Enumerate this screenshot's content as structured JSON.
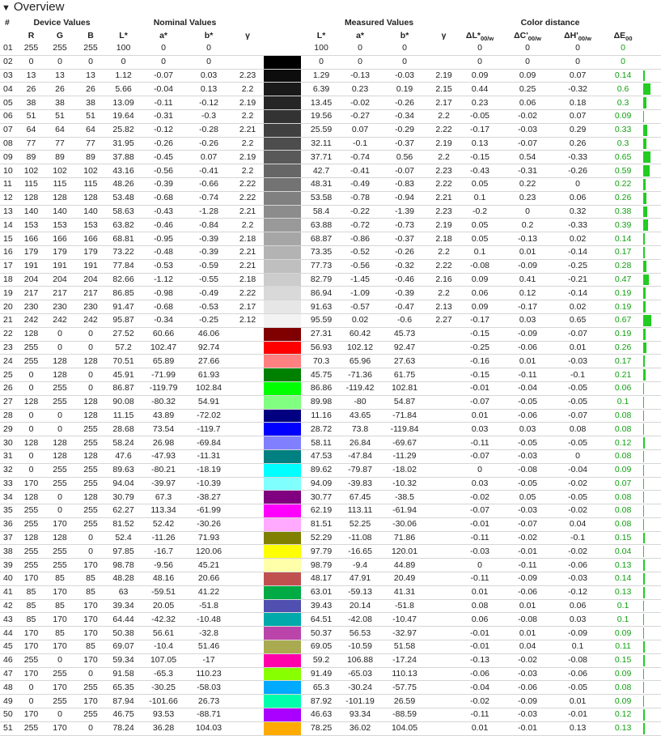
{
  "section": {
    "title": "Overview",
    "toggle_icon": "triangle-down-icon"
  },
  "groups": {
    "index": "#",
    "device": "Device Values",
    "nominal": "Nominal Values",
    "measured": "Measured Values",
    "distance": "Color distance"
  },
  "columns": {
    "r": "R",
    "g": "G",
    "b": "B",
    "nl": "L*",
    "na": "a*",
    "nb": "b*",
    "ng": "γ",
    "ml": "L*",
    "ma": "a*",
    "mb": "b*",
    "mg": "γ",
    "dl": "ΔL*",
    "dc": "ΔC'",
    "dh": "ΔH'",
    "de": "ΔE",
    "sub_dl": "00/w",
    "sub_dc": "00/w",
    "sub_dh": "00/w",
    "sub_de": "00"
  },
  "accent_color": "#22cc22",
  "rows": [
    {
      "id": "01",
      "r": "255",
      "g": "255",
      "b": "255",
      "nl": "100",
      "na": "0",
      "nb": "0",
      "ng": "",
      "swatch": "#ffffff",
      "ml": "100",
      "ma": "0",
      "mb": "0",
      "mg": "",
      "dl": "0",
      "dc": "0",
      "dh": "0",
      "de": "0",
      "bar": 0
    },
    {
      "id": "02",
      "r": "0",
      "g": "0",
      "b": "0",
      "nl": "0",
      "na": "0",
      "nb": "0",
      "ng": "",
      "swatch": "#000000",
      "ml": "0",
      "ma": "0",
      "mb": "0",
      "mg": "",
      "dl": "0",
      "dc": "0",
      "dh": "0",
      "de": "0",
      "bar": 0
    },
    {
      "id": "03",
      "r": "13",
      "g": "13",
      "b": "13",
      "nl": "1.12",
      "na": "-0.07",
      "nb": "0.03",
      "ng": "2.23",
      "swatch": "#0d0d0d",
      "ml": "1.29",
      "ma": "-0.13",
      "mb": "-0.03",
      "mg": "2.19",
      "dl": "0.09",
      "dc": "0.09",
      "dh": "0.07",
      "de": "0.14",
      "bar": 0.14
    },
    {
      "id": "04",
      "r": "26",
      "g": "26",
      "b": "26",
      "nl": "5.66",
      "na": "-0.04",
      "nb": "0.13",
      "ng": "2.2",
      "swatch": "#1a1a1a",
      "ml": "6.39",
      "ma": "0.23",
      "mb": "0.19",
      "mg": "2.15",
      "dl": "0.44",
      "dc": "0.25",
      "dh": "-0.32",
      "de": "0.6",
      "bar": 0.6
    },
    {
      "id": "05",
      "r": "38",
      "g": "38",
      "b": "38",
      "nl": "13.09",
      "na": "-0.11",
      "nb": "-0.12",
      "ng": "2.19",
      "swatch": "#262626",
      "ml": "13.45",
      "ma": "-0.02",
      "mb": "-0.26",
      "mg": "2.17",
      "dl": "0.23",
      "dc": "0.06",
      "dh": "0.18",
      "de": "0.3",
      "bar": 0.3
    },
    {
      "id": "06",
      "r": "51",
      "g": "51",
      "b": "51",
      "nl": "19.64",
      "na": "-0.31",
      "nb": "-0.3",
      "ng": "2.2",
      "swatch": "#333333",
      "ml": "19.56",
      "ma": "-0.27",
      "mb": "-0.34",
      "mg": "2.2",
      "dl": "-0.05",
      "dc": "-0.02",
      "dh": "0.07",
      "de": "0.09",
      "bar": 0.09
    },
    {
      "id": "07",
      "r": "64",
      "g": "64",
      "b": "64",
      "nl": "25.82",
      "na": "-0.12",
      "nb": "-0.28",
      "ng": "2.21",
      "swatch": "#404040",
      "ml": "25.59",
      "ma": "0.07",
      "mb": "-0.29",
      "mg": "2.22",
      "dl": "-0.17",
      "dc": "-0.03",
      "dh": "0.29",
      "de": "0.33",
      "bar": 0.33
    },
    {
      "id": "08",
      "r": "77",
      "g": "77",
      "b": "77",
      "nl": "31.95",
      "na": "-0.26",
      "nb": "-0.26",
      "ng": "2.2",
      "swatch": "#4d4d4d",
      "ml": "32.11",
      "ma": "-0.1",
      "mb": "-0.37",
      "mg": "2.19",
      "dl": "0.13",
      "dc": "-0.07",
      "dh": "0.26",
      "de": "0.3",
      "bar": 0.3
    },
    {
      "id": "09",
      "r": "89",
      "g": "89",
      "b": "89",
      "nl": "37.88",
      "na": "-0.45",
      "nb": "0.07",
      "ng": "2.19",
      "swatch": "#595959",
      "ml": "37.71",
      "ma": "-0.74",
      "mb": "0.56",
      "mg": "2.2",
      "dl": "-0.15",
      "dc": "0.54",
      "dh": "-0.33",
      "de": "0.65",
      "bar": 0.65
    },
    {
      "id": "10",
      "r": "102",
      "g": "102",
      "b": "102",
      "nl": "43.16",
      "na": "-0.56",
      "nb": "-0.41",
      "ng": "2.2",
      "swatch": "#666666",
      "ml": "42.7",
      "ma": "-0.41",
      "mb": "-0.07",
      "mg": "2.23",
      "dl": "-0.43",
      "dc": "-0.31",
      "dh": "-0.26",
      "de": "0.59",
      "bar": 0.59
    },
    {
      "id": "11",
      "r": "115",
      "g": "115",
      "b": "115",
      "nl": "48.26",
      "na": "-0.39",
      "nb": "-0.66",
      "ng": "2.22",
      "swatch": "#737373",
      "ml": "48.31",
      "ma": "-0.49",
      "mb": "-0.83",
      "mg": "2.22",
      "dl": "0.05",
      "dc": "0.22",
      "dh": "0",
      "de": "0.22",
      "bar": 0.22
    },
    {
      "id": "12",
      "r": "128",
      "g": "128",
      "b": "128",
      "nl": "53.48",
      "na": "-0.68",
      "nb": "-0.74",
      "ng": "2.22",
      "swatch": "#808080",
      "ml": "53.58",
      "ma": "-0.78",
      "mb": "-0.94",
      "mg": "2.21",
      "dl": "0.1",
      "dc": "0.23",
      "dh": "0.06",
      "de": "0.26",
      "bar": 0.26
    },
    {
      "id": "13",
      "r": "140",
      "g": "140",
      "b": "140",
      "nl": "58.63",
      "na": "-0.43",
      "nb": "-1.28",
      "ng": "2.21",
      "swatch": "#8c8c8c",
      "ml": "58.4",
      "ma": "-0.22",
      "mb": "-1.39",
      "mg": "2.23",
      "dl": "-0.2",
      "dc": "0",
      "dh": "0.32",
      "de": "0.38",
      "bar": 0.38
    },
    {
      "id": "14",
      "r": "153",
      "g": "153",
      "b": "153",
      "nl": "63.82",
      "na": "-0.46",
      "nb": "-0.84",
      "ng": "2.2",
      "swatch": "#999999",
      "ml": "63.88",
      "ma": "-0.72",
      "mb": "-0.73",
      "mg": "2.19",
      "dl": "0.05",
      "dc": "0.2",
      "dh": "-0.33",
      "de": "0.39",
      "bar": 0.39
    },
    {
      "id": "15",
      "r": "166",
      "g": "166",
      "b": "166",
      "nl": "68.81",
      "na": "-0.95",
      "nb": "-0.39",
      "ng": "2.18",
      "swatch": "#a6a6a6",
      "ml": "68.87",
      "ma": "-0.86",
      "mb": "-0.37",
      "mg": "2.18",
      "dl": "0.05",
      "dc": "-0.13",
      "dh": "0.02",
      "de": "0.14",
      "bar": 0.14
    },
    {
      "id": "16",
      "r": "179",
      "g": "179",
      "b": "179",
      "nl": "73.22",
      "na": "-0.48",
      "nb": "-0.39",
      "ng": "2.21",
      "swatch": "#b3b3b3",
      "ml": "73.35",
      "ma": "-0.52",
      "mb": "-0.26",
      "mg": "2.2",
      "dl": "0.1",
      "dc": "0.01",
      "dh": "-0.14",
      "de": "0.17",
      "bar": 0.17
    },
    {
      "id": "17",
      "r": "191",
      "g": "191",
      "b": "191",
      "nl": "77.84",
      "na": "-0.53",
      "nb": "-0.59",
      "ng": "2.21",
      "swatch": "#bfbfbf",
      "ml": "77.73",
      "ma": "-0.56",
      "mb": "-0.32",
      "mg": "2.22",
      "dl": "-0.08",
      "dc": "-0.09",
      "dh": "-0.25",
      "de": "0.28",
      "bar": 0.28
    },
    {
      "id": "18",
      "r": "204",
      "g": "204",
      "b": "204",
      "nl": "82.66",
      "na": "-1.12",
      "nb": "-0.55",
      "ng": "2.18",
      "swatch": "#cccccc",
      "ml": "82.79",
      "ma": "-1.45",
      "mb": "-0.46",
      "mg": "2.16",
      "dl": "0.09",
      "dc": "0.41",
      "dh": "-0.21",
      "de": "0.47",
      "bar": 0.47
    },
    {
      "id": "19",
      "r": "217",
      "g": "217",
      "b": "217",
      "nl": "86.85",
      "na": "-0.98",
      "nb": "-0.49",
      "ng": "2.22",
      "swatch": "#d9d9d9",
      "ml": "86.94",
      "ma": "-1.09",
      "mb": "-0.39",
      "mg": "2.2",
      "dl": "0.06",
      "dc": "0.12",
      "dh": "-0.14",
      "de": "0.19",
      "bar": 0.19
    },
    {
      "id": "20",
      "r": "230",
      "g": "230",
      "b": "230",
      "nl": "91.47",
      "na": "-0.68",
      "nb": "-0.53",
      "ng": "2.17",
      "swatch": "#e6e6e6",
      "ml": "91.63",
      "ma": "-0.57",
      "mb": "-0.47",
      "mg": "2.13",
      "dl": "0.09",
      "dc": "-0.17",
      "dh": "0.02",
      "de": "0.19",
      "bar": 0.19
    },
    {
      "id": "21",
      "r": "242",
      "g": "242",
      "b": "242",
      "nl": "95.87",
      "na": "-0.34",
      "nb": "-0.25",
      "ng": "2.12",
      "swatch": "#f2f2f2",
      "ml": "95.59",
      "ma": "0.02",
      "mb": "-0.6",
      "mg": "2.27",
      "dl": "-0.17",
      "dc": "0.03",
      "dh": "0.65",
      "de": "0.67",
      "bar": 0.67
    },
    {
      "id": "22",
      "r": "128",
      "g": "0",
      "b": "0",
      "nl": "27.52",
      "na": "60.66",
      "nb": "46.06",
      "ng": "",
      "swatch": "#800000",
      "ml": "27.31",
      "ma": "60.42",
      "mb": "45.73",
      "mg": "",
      "dl": "-0.15",
      "dc": "-0.09",
      "dh": "-0.07",
      "de": "0.19",
      "bar": 0.19
    },
    {
      "id": "23",
      "r": "255",
      "g": "0",
      "b": "0",
      "nl": "57.2",
      "na": "102.47",
      "nb": "92.74",
      "ng": "",
      "swatch": "#ff0000",
      "ml": "56.93",
      "ma": "102.12",
      "mb": "92.47",
      "mg": "",
      "dl": "-0.25",
      "dc": "-0.06",
      "dh": "0.01",
      "de": "0.26",
      "bar": 0.26
    },
    {
      "id": "24",
      "r": "255",
      "g": "128",
      "b": "128",
      "nl": "70.51",
      "na": "65.89",
      "nb": "27.66",
      "ng": "",
      "swatch": "#ff8080",
      "ml": "70.3",
      "ma": "65.96",
      "mb": "27.63",
      "mg": "",
      "dl": "-0.16",
      "dc": "0.01",
      "dh": "-0.03",
      "de": "0.17",
      "bar": 0.17
    },
    {
      "id": "25",
      "r": "0",
      "g": "128",
      "b": "0",
      "nl": "45.91",
      "na": "-71.99",
      "nb": "61.93",
      "ng": "",
      "swatch": "#008000",
      "ml": "45.75",
      "ma": "-71.36",
      "mb": "61.75",
      "mg": "",
      "dl": "-0.15",
      "dc": "-0.11",
      "dh": "-0.1",
      "de": "0.21",
      "bar": 0.21
    },
    {
      "id": "26",
      "r": "0",
      "g": "255",
      "b": "0",
      "nl": "86.87",
      "na": "-119.79",
      "nb": "102.84",
      "ng": "",
      "swatch": "#00ff00",
      "ml": "86.86",
      "ma": "-119.42",
      "mb": "102.81",
      "mg": "",
      "dl": "-0.01",
      "dc": "-0.04",
      "dh": "-0.05",
      "de": "0.06",
      "bar": 0.06
    },
    {
      "id": "27",
      "r": "128",
      "g": "255",
      "b": "128",
      "nl": "90.08",
      "na": "-80.32",
      "nb": "54.91",
      "ng": "",
      "swatch": "#80ff80",
      "ml": "89.98",
      "ma": "-80",
      "mb": "54.87",
      "mg": "",
      "dl": "-0.07",
      "dc": "-0.05",
      "dh": "-0.05",
      "de": "0.1",
      "bar": 0.1
    },
    {
      "id": "28",
      "r": "0",
      "g": "0",
      "b": "128",
      "nl": "11.15",
      "na": "43.89",
      "nb": "-72.02",
      "ng": "",
      "swatch": "#000080",
      "ml": "11.16",
      "ma": "43.65",
      "mb": "-71.84",
      "mg": "",
      "dl": "0.01",
      "dc": "-0.06",
      "dh": "-0.07",
      "de": "0.08",
      "bar": 0.08
    },
    {
      "id": "29",
      "r": "0",
      "g": "0",
      "b": "255",
      "nl": "28.68",
      "na": "73.54",
      "nb": "-119.7",
      "ng": "",
      "swatch": "#0000ff",
      "ml": "28.72",
      "ma": "73.8",
      "mb": "-119.84",
      "mg": "",
      "dl": "0.03",
      "dc": "0.03",
      "dh": "0.08",
      "de": "0.08",
      "bar": 0.08
    },
    {
      "id": "30",
      "r": "128",
      "g": "128",
      "b": "255",
      "nl": "58.24",
      "na": "26.98",
      "nb": "-69.84",
      "ng": "",
      "swatch": "#8080ff",
      "ml": "58.11",
      "ma": "26.84",
      "mb": "-69.67",
      "mg": "",
      "dl": "-0.11",
      "dc": "-0.05",
      "dh": "-0.05",
      "de": "0.12",
      "bar": 0.12
    },
    {
      "id": "31",
      "r": "0",
      "g": "128",
      "b": "128",
      "nl": "47.6",
      "na": "-47.93",
      "nb": "-11.31",
      "ng": "",
      "swatch": "#008080",
      "ml": "47.53",
      "ma": "-47.84",
      "mb": "-11.29",
      "mg": "",
      "dl": "-0.07",
      "dc": "-0.03",
      "dh": "0",
      "de": "0.08",
      "bar": 0.08
    },
    {
      "id": "32",
      "r": "0",
      "g": "255",
      "b": "255",
      "nl": "89.63",
      "na": "-80.21",
      "nb": "-18.19",
      "ng": "",
      "swatch": "#00ffff",
      "ml": "89.62",
      "ma": "-79.87",
      "mb": "-18.02",
      "mg": "",
      "dl": "0",
      "dc": "-0.08",
      "dh": "-0.04",
      "de": "0.09",
      "bar": 0.09
    },
    {
      "id": "33",
      "r": "170",
      "g": "255",
      "b": "255",
      "nl": "94.04",
      "na": "-39.97",
      "nb": "-10.39",
      "ng": "",
      "swatch": "#80ffff",
      "ml": "94.09",
      "ma": "-39.83",
      "mb": "-10.32",
      "mg": "",
      "dl": "0.03",
      "dc": "-0.05",
      "dh": "-0.02",
      "de": "0.07",
      "bar": 0.07
    },
    {
      "id": "34",
      "r": "128",
      "g": "0",
      "b": "128",
      "nl": "30.79",
      "na": "67.3",
      "nb": "-38.27",
      "ng": "",
      "swatch": "#800080",
      "ml": "30.77",
      "ma": "67.45",
      "mb": "-38.5",
      "mg": "",
      "dl": "-0.02",
      "dc": "0.05",
      "dh": "-0.05",
      "de": "0.08",
      "bar": 0.08
    },
    {
      "id": "35",
      "r": "255",
      "g": "0",
      "b": "255",
      "nl": "62.27",
      "na": "113.34",
      "nb": "-61.99",
      "ng": "",
      "swatch": "#ff00ff",
      "ml": "62.19",
      "ma": "113.11",
      "mb": "-61.94",
      "mg": "",
      "dl": "-0.07",
      "dc": "-0.03",
      "dh": "-0.02",
      "de": "0.08",
      "bar": 0.08
    },
    {
      "id": "36",
      "r": "255",
      "g": "170",
      "b": "255",
      "nl": "81.52",
      "na": "52.42",
      "nb": "-30.26",
      "ng": "",
      "swatch": "#ffaaff",
      "ml": "81.51",
      "ma": "52.25",
      "mb": "-30.06",
      "mg": "",
      "dl": "-0.01",
      "dc": "-0.07",
      "dh": "0.04",
      "de": "0.08",
      "bar": 0.08
    },
    {
      "id": "37",
      "r": "128",
      "g": "128",
      "b": "0",
      "nl": "52.4",
      "na": "-11.26",
      "nb": "71.93",
      "ng": "",
      "swatch": "#808000",
      "ml": "52.29",
      "ma": "-11.08",
      "mb": "71.86",
      "mg": "",
      "dl": "-0.11",
      "dc": "-0.02",
      "dh": "-0.1",
      "de": "0.15",
      "bar": 0.15
    },
    {
      "id": "38",
      "r": "255",
      "g": "255",
      "b": "0",
      "nl": "97.85",
      "na": "-16.7",
      "nb": "120.06",
      "ng": "",
      "swatch": "#ffff00",
      "ml": "97.79",
      "ma": "-16.65",
      "mb": "120.01",
      "mg": "",
      "dl": "-0.03",
      "dc": "-0.01",
      "dh": "-0.02",
      "de": "0.04",
      "bar": 0.04
    },
    {
      "id": "39",
      "r": "255",
      "g": "255",
      "b": "170",
      "nl": "98.78",
      "na": "-9.56",
      "nb": "45.21",
      "ng": "",
      "swatch": "#ffffaa",
      "ml": "98.79",
      "ma": "-9.4",
      "mb": "44.89",
      "mg": "",
      "dl": "0",
      "dc": "-0.11",
      "dh": "-0.06",
      "de": "0.13",
      "bar": 0.13
    },
    {
      "id": "40",
      "r": "170",
      "g": "85",
      "b": "85",
      "nl": "48.28",
      "na": "48.16",
      "nb": "20.66",
      "ng": "",
      "swatch": "#c05050",
      "ml": "48.17",
      "ma": "47.91",
      "mb": "20.49",
      "mg": "",
      "dl": "-0.11",
      "dc": "-0.09",
      "dh": "-0.03",
      "de": "0.14",
      "bar": 0.14
    },
    {
      "id": "41",
      "r": "85",
      "g": "170",
      "b": "85",
      "nl": "63",
      "na": "-59.51",
      "nb": "41.22",
      "ng": "",
      "swatch": "#00aa44",
      "ml": "63.01",
      "ma": "-59.13",
      "mb": "41.31",
      "mg": "",
      "dl": "0.01",
      "dc": "-0.06",
      "dh": "-0.12",
      "de": "0.13",
      "bar": 0.13
    },
    {
      "id": "42",
      "r": "85",
      "g": "85",
      "b": "170",
      "nl": "39.34",
      "na": "20.05",
      "nb": "-51.8",
      "ng": "",
      "swatch": "#5050b0",
      "ml": "39.43",
      "ma": "20.14",
      "mb": "-51.8",
      "mg": "",
      "dl": "0.08",
      "dc": "0.01",
      "dh": "0.06",
      "de": "0.1",
      "bar": 0.1
    },
    {
      "id": "43",
      "r": "85",
      "g": "170",
      "b": "170",
      "nl": "64.44",
      "na": "-42.32",
      "nb": "-10.48",
      "ng": "",
      "swatch": "#00aaaa",
      "ml": "64.51",
      "ma": "-42.08",
      "mb": "-10.47",
      "mg": "",
      "dl": "0.06",
      "dc": "-0.08",
      "dh": "0.03",
      "de": "0.1",
      "bar": 0.1
    },
    {
      "id": "44",
      "r": "170",
      "g": "85",
      "b": "170",
      "nl": "50.38",
      "na": "56.61",
      "nb": "-32.8",
      "ng": "",
      "swatch": "#bb44aa",
      "ml": "50.37",
      "ma": "56.53",
      "mb": "-32.97",
      "mg": "",
      "dl": "-0.01",
      "dc": "0.01",
      "dh": "-0.09",
      "de": "0.09",
      "bar": 0.09
    },
    {
      "id": "45",
      "r": "170",
      "g": "170",
      "b": "85",
      "nl": "69.07",
      "na": "-10.4",
      "nb": "51.46",
      "ng": "",
      "swatch": "#aaaa50",
      "ml": "69.05",
      "ma": "-10.59",
      "mb": "51.58",
      "mg": "",
      "dl": "-0.01",
      "dc": "0.04",
      "dh": "0.1",
      "de": "0.11",
      "bar": 0.11
    },
    {
      "id": "46",
      "r": "255",
      "g": "0",
      "b": "170",
      "nl": "59.34",
      "na": "107.05",
      "nb": "-17",
      "ng": "",
      "swatch": "#ff00aa",
      "ml": "59.2",
      "ma": "106.88",
      "mb": "-17.24",
      "mg": "",
      "dl": "-0.13",
      "dc": "-0.02",
      "dh": "-0.08",
      "de": "0.15",
      "bar": 0.15
    },
    {
      "id": "47",
      "r": "170",
      "g": "255",
      "b": "0",
      "nl": "91.58",
      "na": "-65.3",
      "nb": "110.23",
      "ng": "",
      "swatch": "#88ff00",
      "ml": "91.49",
      "ma": "-65.03",
      "mb": "110.13",
      "mg": "",
      "dl": "-0.06",
      "dc": "-0.03",
      "dh": "-0.06",
      "de": "0.09",
      "bar": 0.09
    },
    {
      "id": "48",
      "r": "0",
      "g": "170",
      "b": "255",
      "nl": "65.35",
      "na": "-30.25",
      "nb": "-58.03",
      "ng": "",
      "swatch": "#00aaff",
      "ml": "65.3",
      "ma": "-30.24",
      "mb": "-57.75",
      "mg": "",
      "dl": "-0.04",
      "dc": "-0.06",
      "dh": "-0.05",
      "de": "0.08",
      "bar": 0.08
    },
    {
      "id": "49",
      "r": "0",
      "g": "255",
      "b": "170",
      "nl": "87.94",
      "na": "-101.66",
      "nb": "26.73",
      "ng": "",
      "swatch": "#00ffaa",
      "ml": "87.92",
      "ma": "-101.19",
      "mb": "26.59",
      "mg": "",
      "dl": "-0.02",
      "dc": "-0.09",
      "dh": "0.01",
      "de": "0.09",
      "bar": 0.09
    },
    {
      "id": "50",
      "r": "170",
      "g": "0",
      "b": "255",
      "nl": "46.75",
      "na": "93.53",
      "nb": "-88.71",
      "ng": "",
      "swatch": "#aa00ff",
      "ml": "46.63",
      "ma": "93.34",
      "mb": "-88.59",
      "mg": "",
      "dl": "-0.11",
      "dc": "-0.03",
      "dh": "-0.01",
      "de": "0.12",
      "bar": 0.12
    },
    {
      "id": "51",
      "r": "255",
      "g": "170",
      "b": "0",
      "nl": "78.24",
      "na": "36.28",
      "nb": "104.03",
      "ng": "",
      "swatch": "#ffaa00",
      "ml": "78.25",
      "ma": "36.02",
      "mb": "104.05",
      "mg": "",
      "dl": "0.01",
      "dc": "-0.01",
      "dh": "0.13",
      "de": "0.13",
      "bar": 0.13
    }
  ]
}
